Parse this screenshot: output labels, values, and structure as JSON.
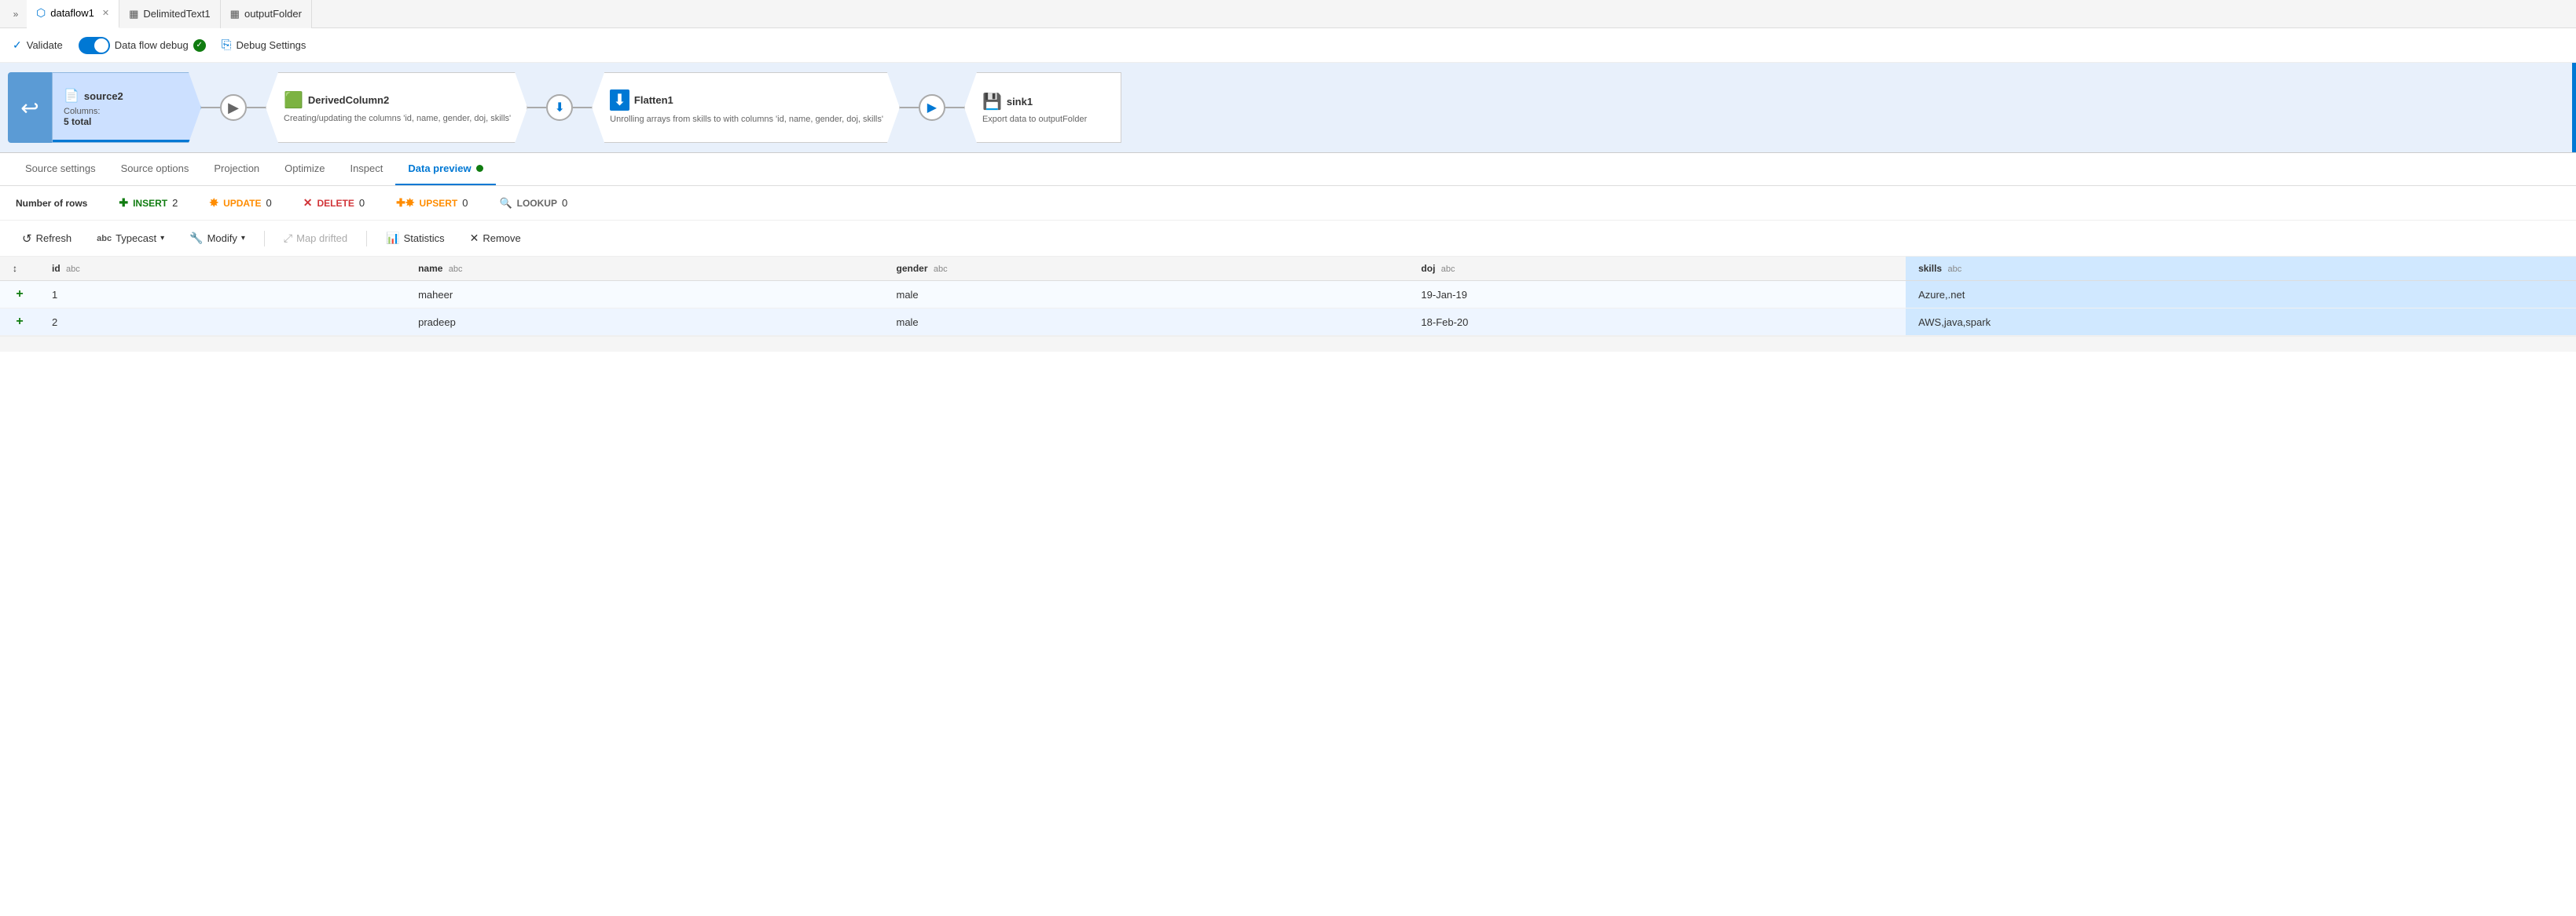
{
  "tabs": [
    {
      "id": "dataflow1",
      "label": "dataflow1",
      "icon": "⬡",
      "active": true,
      "closable": true
    },
    {
      "id": "delimitedtext1",
      "label": "DelimitedText1",
      "icon": "▦",
      "active": false,
      "closable": false
    },
    {
      "id": "outputFolder",
      "label": "outputFolder",
      "icon": "▦",
      "active": false,
      "closable": false
    }
  ],
  "toolbar": {
    "validate_label": "Validate",
    "debug_label": "Data flow debug",
    "debug_settings_label": "Debug Settings"
  },
  "pipeline": {
    "nodes": [
      {
        "id": "source2",
        "title": "source2",
        "icon": "📄",
        "subtitle": "Columns:",
        "detail": "5 total",
        "active": true
      },
      {
        "id": "derivedcolumn2",
        "title": "DerivedColumn2",
        "icon": "➕",
        "subtitle": "Creating/updating the columns 'id, name, gender, doj, skills'",
        "detail": "",
        "active": false
      },
      {
        "id": "flatten1",
        "title": "Flatten1",
        "icon": "⬇",
        "subtitle": "Unrolling arrays from skills to with columns 'id, name, gender, doj, skills'",
        "detail": "",
        "active": false
      },
      {
        "id": "sink1",
        "title": "sink1",
        "icon": "💾",
        "subtitle": "Export data to outputFolder",
        "detail": "",
        "active": false
      }
    ]
  },
  "nav_tabs": [
    {
      "id": "source-settings",
      "label": "Source settings",
      "active": false
    },
    {
      "id": "source-options",
      "label": "Source options",
      "active": false
    },
    {
      "id": "projection",
      "label": "Projection",
      "active": false
    },
    {
      "id": "optimize",
      "label": "Optimize",
      "active": false
    },
    {
      "id": "inspect",
      "label": "Inspect",
      "active": false
    },
    {
      "id": "data-preview",
      "label": "Data preview",
      "active": true
    }
  ],
  "stats": {
    "rows_label": "Number of rows",
    "insert_label": "INSERT",
    "insert_count": "2",
    "update_label": "UPDATE",
    "update_count": "0",
    "delete_label": "DELETE",
    "delete_count": "0",
    "upsert_label": "UPSERT",
    "upsert_count": "0",
    "lookup_label": "LOOKUP",
    "lookup_count": "0"
  },
  "actions": {
    "refresh_label": "Refresh",
    "typecast_label": "Typecast",
    "modify_label": "Modify",
    "map_drifted_label": "Map drifted",
    "statistics_label": "Statistics",
    "remove_label": "Remove"
  },
  "table": {
    "columns": [
      {
        "id": "id",
        "label": "id",
        "type": "abc",
        "highlighted": false
      },
      {
        "id": "name",
        "label": "name",
        "type": "abc",
        "highlighted": false
      },
      {
        "id": "gender",
        "label": "gender",
        "type": "abc",
        "highlighted": false
      },
      {
        "id": "doj",
        "label": "doj",
        "type": "abc",
        "highlighted": false
      },
      {
        "id": "skills",
        "label": "skills",
        "type": "abc",
        "highlighted": true
      }
    ],
    "rows": [
      {
        "insert": "+",
        "id": "1",
        "name": "maheer",
        "gender": "male",
        "doj": "19-Jan-19",
        "skills": "Azure,.net",
        "even": true
      },
      {
        "insert": "+",
        "id": "2",
        "name": "pradeep",
        "gender": "male",
        "doj": "18-Feb-20",
        "skills": "AWS,java,spark",
        "even": false
      }
    ]
  }
}
